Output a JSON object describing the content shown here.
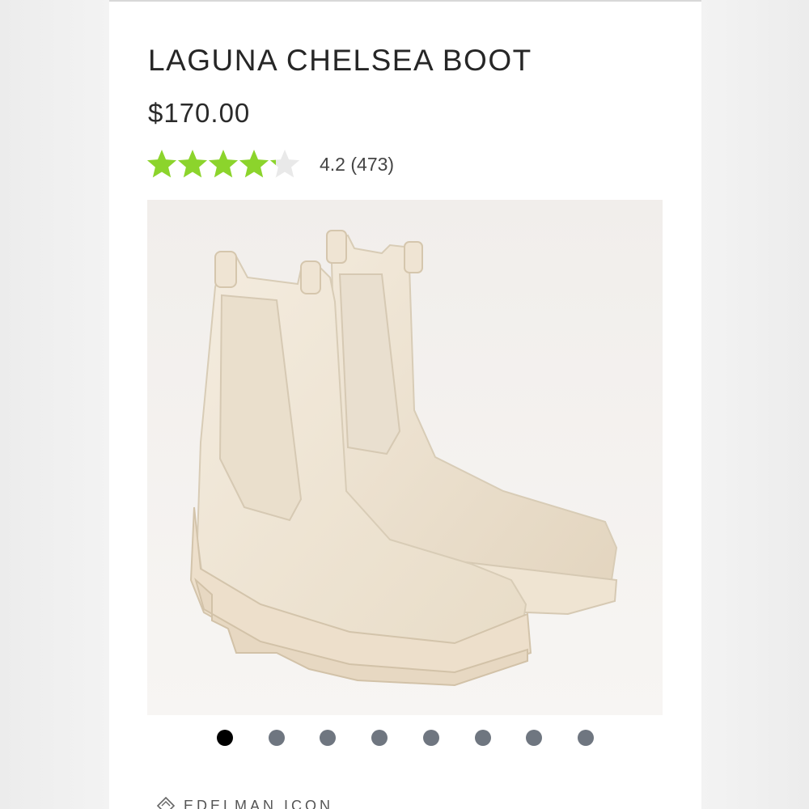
{
  "product": {
    "title": "LAGUNA CHELSEA BOOT",
    "price": "$170.00",
    "rating": {
      "value": 4.2,
      "max": 5,
      "text": "4.2 (473)",
      "star_color": "#8cd42c",
      "empty_star_color": "#e9e9e9"
    },
    "image": {
      "description_icon": "product-photo",
      "boot_color": "#efe6d6"
    },
    "gallery": {
      "count": 8,
      "active_index": 0
    },
    "brand_label": "EDELMAN ICON",
    "brand_icon": "diamond-icon"
  }
}
